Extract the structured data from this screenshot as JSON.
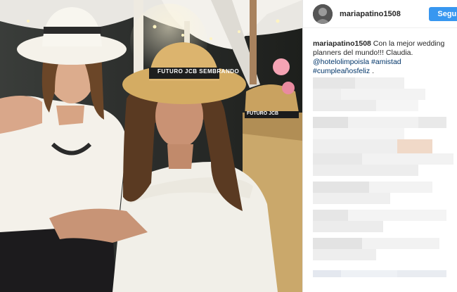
{
  "post": {
    "username": "mariapatino1508",
    "follow_label": "Seguir",
    "caption": {
      "username": "mariapatino1508",
      "text": "Con la mejor wedding planners del mundo!!! Claudia.",
      "mention": "@hotelolimpoisla",
      "hashtags": [
        "#amistad",
        "#cumpleañosfeliz"
      ],
      "trailing": "."
    },
    "hat_band_text": "FUTURO JCB SEMBRANDO",
    "hat_band_text_2": "FUTURO JCB"
  },
  "colors": {
    "accent": "#3897f0",
    "link": "#003569",
    "text": "#262626"
  }
}
